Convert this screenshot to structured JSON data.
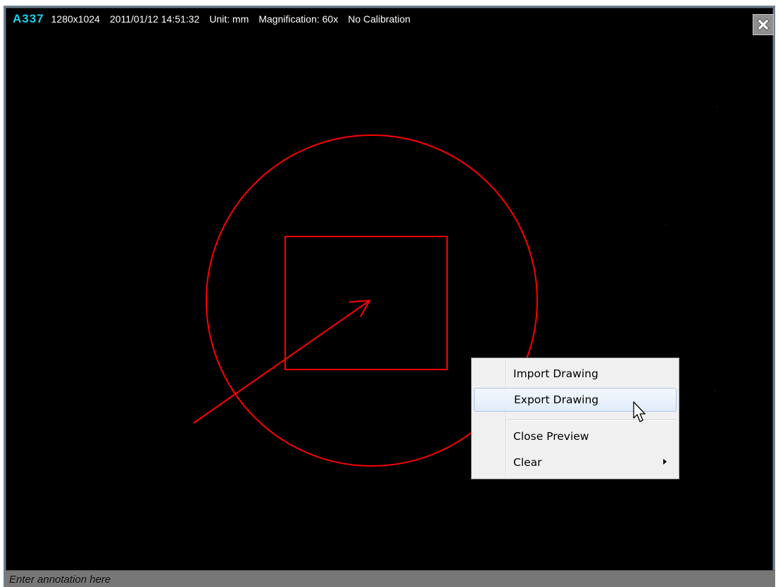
{
  "viewer": {
    "camera_id": "A337",
    "resolution": "1280x1024",
    "datetime": "2011/01/12 14:51:32",
    "unit": "Unit: mm",
    "magnification": "Magnification:  60x",
    "calibration": "No Calibration"
  },
  "close_icon": "close-x-icon",
  "drawing": {
    "stroke_color": "#ff0000",
    "shapes": [
      "circle",
      "rectangle",
      "arrow"
    ]
  },
  "context_menu": {
    "items": [
      {
        "label": "Import Drawing"
      },
      {
        "label": "Export Drawing",
        "highlighted": true
      },
      {
        "label": "Close Preview"
      },
      {
        "label": "Clear",
        "has_submenu": true
      }
    ]
  },
  "annotation": {
    "placeholder": "Enter annotation here"
  },
  "colors": {
    "camera_id": "#16d4f0",
    "background": "#000000",
    "annotation_bar": "#777777"
  }
}
